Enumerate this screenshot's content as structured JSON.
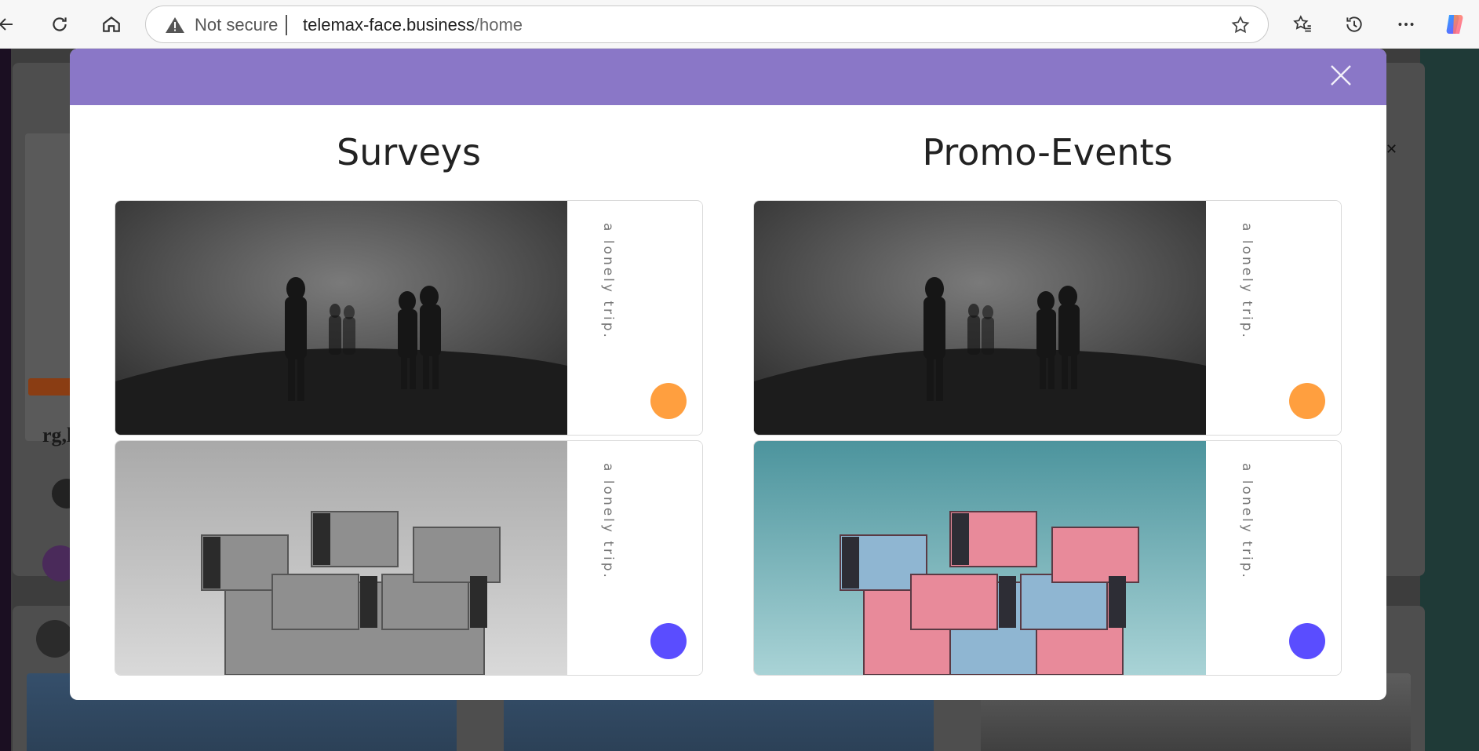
{
  "browser": {
    "security_label": "Not secure",
    "url_host": "telemax-face.business",
    "url_path": "/home"
  },
  "background_page": {
    "partial_name": "rg,l"
  },
  "modal": {
    "header_color": "#8a77c7",
    "columns": [
      {
        "title": "Surveys",
        "cards": [
          {
            "caption": "a lonely trip.",
            "dot_color": "#ff9f3f",
            "image": "foggy-people"
          },
          {
            "caption": "a lonely trip.",
            "dot_color": "#5a4dff",
            "image": "grey-architecture"
          }
        ]
      },
      {
        "title": "Promo-Events",
        "cards": [
          {
            "caption": "a lonely trip.",
            "dot_color": "#ff9f3f",
            "image": "foggy-people"
          },
          {
            "caption": "a lonely trip.",
            "dot_color": "#5a4dff",
            "image": "colorful-architecture"
          }
        ]
      }
    ]
  }
}
